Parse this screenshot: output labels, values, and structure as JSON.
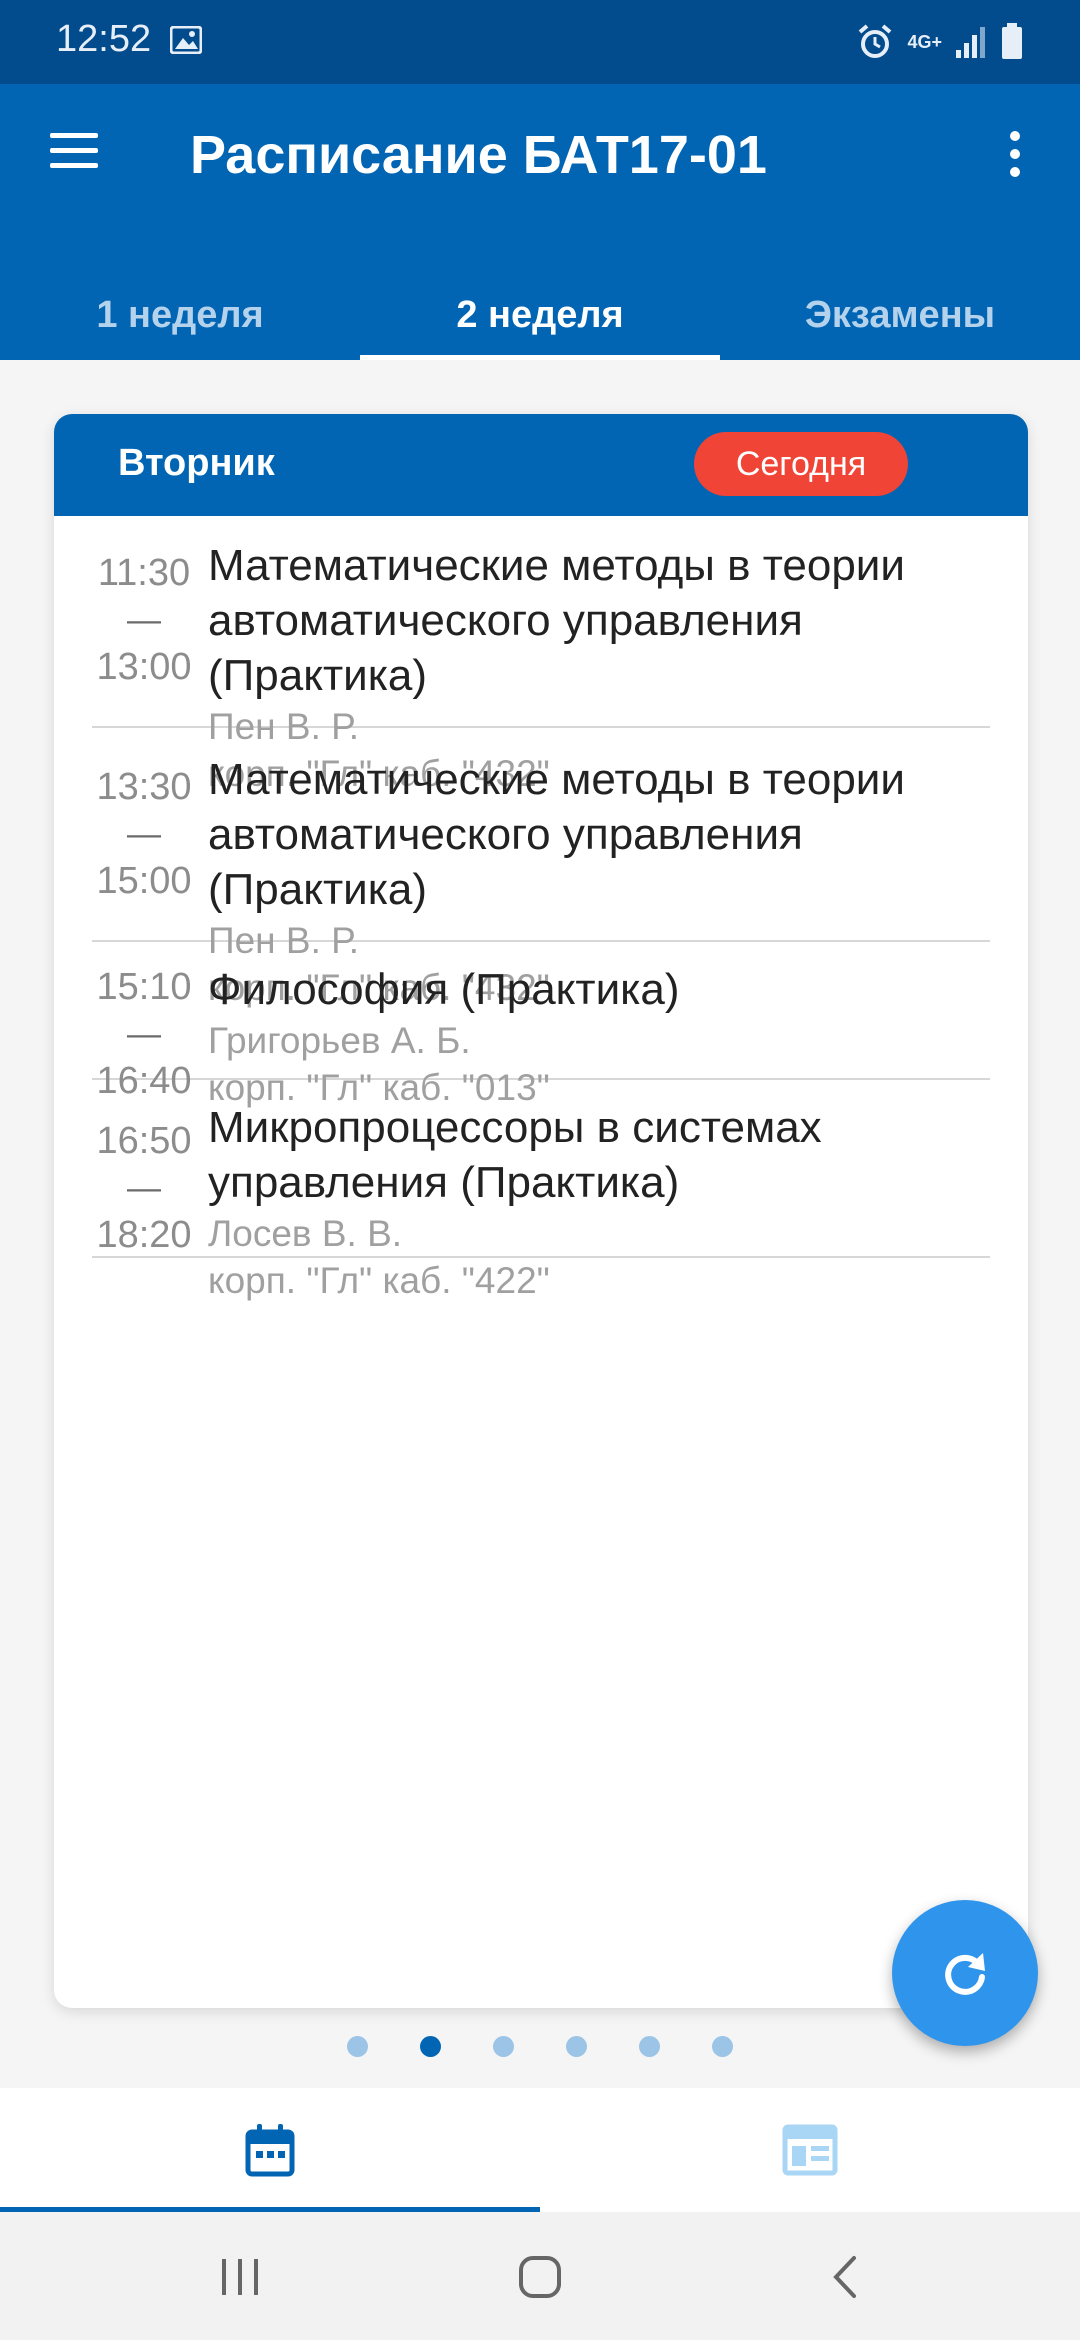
{
  "status_bar": {
    "time": "12:52",
    "network": "4G+"
  },
  "app_bar": {
    "title": "Расписание БАТ17-01"
  },
  "tabs": [
    {
      "label": "1 неделя",
      "active": false
    },
    {
      "label": "2 неделя",
      "active": true
    },
    {
      "label": "Экзамены",
      "active": false
    }
  ],
  "day_card": {
    "day": "Вторник",
    "badge": "Сегодня",
    "lessons": [
      {
        "start": "11:30",
        "dash": "—",
        "end": "13:00",
        "title_lines": [
          "Математические методы в теории",
          "автоматического управления",
          "(Практика)"
        ],
        "teacher": "Пен В. Р.",
        "room": "корп. \"Гл\" каб. \"432\""
      },
      {
        "start": "13:30",
        "dash": "—",
        "end": "15:00",
        "title_lines": [
          "Математические методы в теории",
          "автоматического управления",
          "(Практика)"
        ],
        "teacher": "Пен В. Р.",
        "room": "корп. \"Гл\" каб. \"432\""
      },
      {
        "start": "15:10",
        "dash": "—",
        "end": "16:40",
        "title_lines": [
          "Философия (Практика)"
        ],
        "teacher": "Григорьев А. Б.",
        "room": "корп. \"Гл\" каб. \"013\""
      },
      {
        "start": "16:50",
        "dash": "—",
        "end": "18:20",
        "title_lines": [
          "Микропроцессоры в системах",
          "управления (Практика)"
        ],
        "teacher": "Лосев В. В.",
        "room": "корп. \"Гл\" каб. \"422\""
      }
    ]
  },
  "pager": {
    "count": 6,
    "current": 2
  },
  "fab": {
    "icon": "refresh-icon"
  },
  "bottom_nav": [
    {
      "icon": "calendar-icon",
      "active": true
    },
    {
      "icon": "schedule-table-icon",
      "active": false
    }
  ],
  "colors": {
    "primary": "#0265b3",
    "status_bar": "#024b8c",
    "badge": "#f04436",
    "fab": "#2f95ec"
  }
}
